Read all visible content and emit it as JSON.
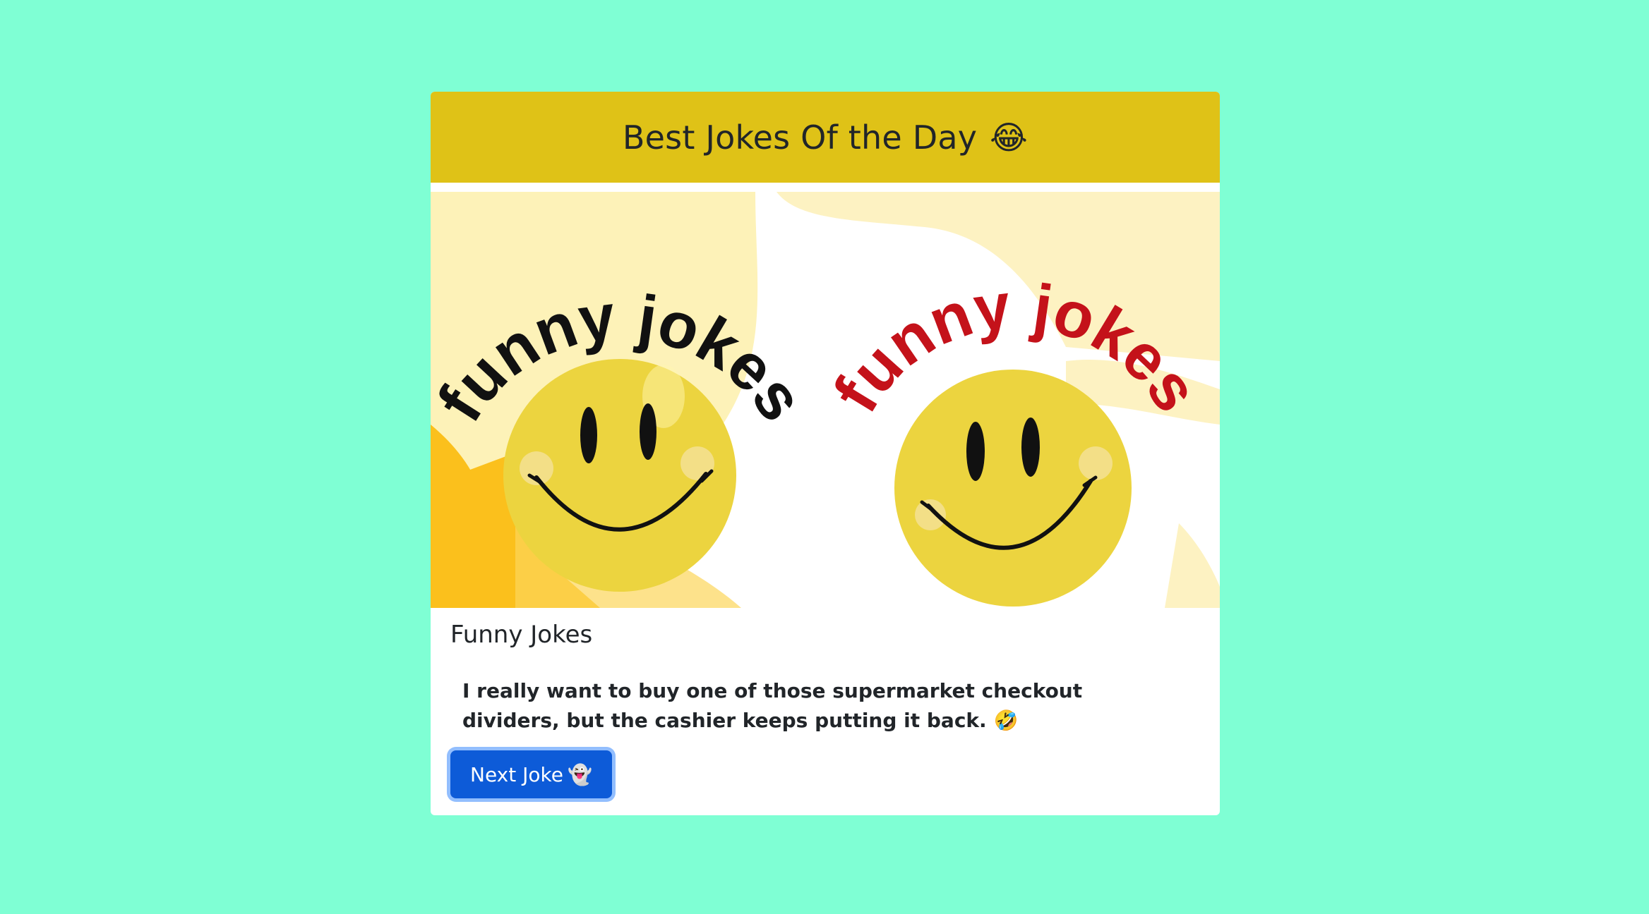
{
  "header": {
    "title": "Best Jokes Of the Day",
    "title_emoji": "😂"
  },
  "hero_image": {
    "left_text": "funny jokes",
    "right_text": "funny jokes",
    "left_text_color": "#111111",
    "right_text_color": "#c4121a",
    "face_color": "#ecd43f"
  },
  "card": {
    "title": "Funny Jokes",
    "joke_text": "I really want to buy one of those supermarket checkout dividers, but the cashier keeps putting it back.",
    "joke_emoji": "🤣",
    "next_button_label": "Next Joke",
    "next_button_emoji": "👻"
  },
  "colors": {
    "page_background": "#7fffd4",
    "header_background": "#dfc217",
    "button_background": "#0d5bd8"
  }
}
